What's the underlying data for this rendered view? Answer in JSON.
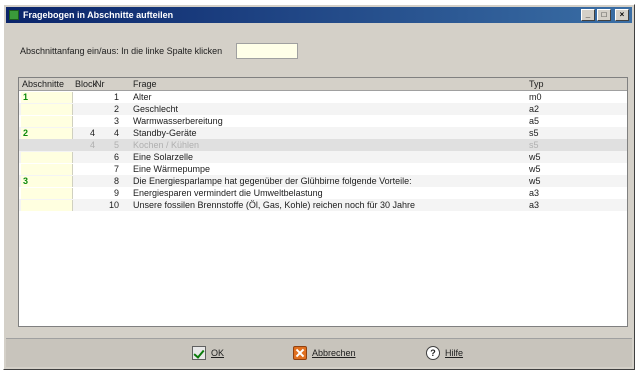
{
  "window": {
    "title": "Fragebogen in Abschnitte aufteilen",
    "controls": {
      "minimize": "_",
      "maximize": "□",
      "close": "×"
    }
  },
  "hint": {
    "label": "Abschnittanfang ein/aus: In die linke Spalte klicken",
    "value": ""
  },
  "table": {
    "columns": {
      "abschnitte": "Abschnitte",
      "block": "Block",
      "nr": "Nr",
      "frage": "Frage",
      "typ": "Typ"
    },
    "rows": [
      {
        "abschnitt": "1",
        "block": "",
        "nr": "1",
        "frage": "Alter",
        "typ": "m0"
      },
      {
        "abschnitt": "",
        "block": "",
        "nr": "2",
        "frage": "Geschlecht",
        "typ": "a2"
      },
      {
        "abschnitt": "",
        "block": "",
        "nr": "3",
        "frage": "Warmwasserbereitung",
        "typ": "a5"
      },
      {
        "abschnitt": "2",
        "block": "4",
        "nr": "4",
        "frage": "Standby-Geräte",
        "typ": "s5"
      },
      {
        "abschnitt": "",
        "block": "4",
        "nr": "5",
        "frage": "Kochen / Kühlen",
        "typ": "s5"
      },
      {
        "abschnitt": "",
        "block": "",
        "nr": "6",
        "frage": "Eine Solarzelle",
        "typ": "w5"
      },
      {
        "abschnitt": "",
        "block": "",
        "nr": "7",
        "frage": "Eine Wärmepumpe",
        "typ": "w5"
      },
      {
        "abschnitt": "3",
        "block": "",
        "nr": "8",
        "frage": "Die Energiesparlampe hat gegenüber der Glühbirne folgende Vorteile:",
        "typ": "w5"
      },
      {
        "abschnitt": "",
        "block": "",
        "nr": "9",
        "frage": "Energiesparen vermindert die Umweltbelastung",
        "typ": "a3"
      },
      {
        "abschnitt": "",
        "block": "",
        "nr": "10",
        "frage": "Unsere fossilen Brennstoffe (Öl, Gas, Kohle) reichen noch für 30 Jahre",
        "typ": "a3"
      }
    ]
  },
  "buttons": {
    "ok": {
      "label": "OK",
      "icon": "ok-icon"
    },
    "cancel": {
      "label": "Abbrechen",
      "icon": "cancel-icon"
    },
    "help": {
      "label": "Hilfe",
      "icon": "help-icon"
    }
  },
  "colors": {
    "title_bar": "#0a246a",
    "section_marker": "#0a8a0a",
    "input_bg": "#ffffe0"
  }
}
